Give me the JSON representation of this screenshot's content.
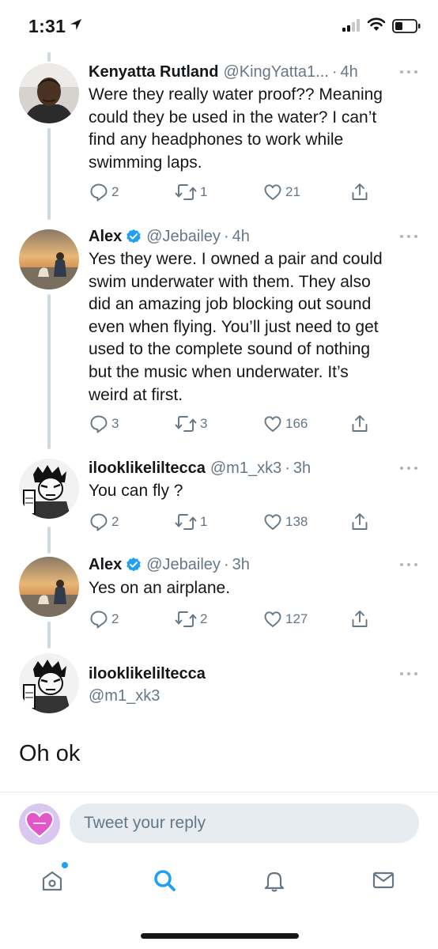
{
  "status_bar": {
    "time": "1:31"
  },
  "tweets": [
    {
      "name": "Kenyatta Rutland",
      "handle": "@KingYatta1...",
      "time": "4h",
      "verified": false,
      "lines": [
        "Were they really water proof?? Meaning",
        "could they be used in the water? I can’t",
        "find any headphones to work while",
        "swimming laps."
      ],
      "replies": "2",
      "retweets": "1",
      "likes": "21"
    },
    {
      "name": "Alex",
      "handle": "@Jebailey",
      "time": "4h",
      "verified": true,
      "lines": [
        "Yes they were. I owned a pair and could",
        "swim underwater with them. They also",
        "did an amazing job blocking out sound",
        "even when flying. You’ll just need to get",
        "used to the complete sound of nothing",
        "but the music when underwater. It’s",
        "weird at first."
      ],
      "replies": "3",
      "retweets": "3",
      "likes": "166"
    },
    {
      "name": "ilooklikeliltecca",
      "handle": "@m1_xk3",
      "time": "3h",
      "verified": false,
      "lines": [
        "You can fly ?"
      ],
      "replies": "2",
      "retweets": "1",
      "likes": "138"
    },
    {
      "name": "Alex",
      "handle": "@Jebailey",
      "time": "3h",
      "verified": true,
      "lines": [
        "Yes on an airplane."
      ],
      "replies": "2",
      "retweets": "2",
      "likes": "127"
    }
  ],
  "focused_tweet": {
    "name": "ilooklikeliltecca",
    "handle": "@m1_xk3",
    "text": "Oh ok"
  },
  "reply": {
    "placeholder": "Tweet your reply"
  },
  "colors": {
    "accent": "#1da1f2",
    "secondary_text": "#657786",
    "thread_line": "#cfd9de"
  },
  "tabbar": {
    "icons": [
      "home-icon",
      "search-icon",
      "notifications-icon",
      "messages-icon"
    ],
    "active": "search-icon"
  }
}
